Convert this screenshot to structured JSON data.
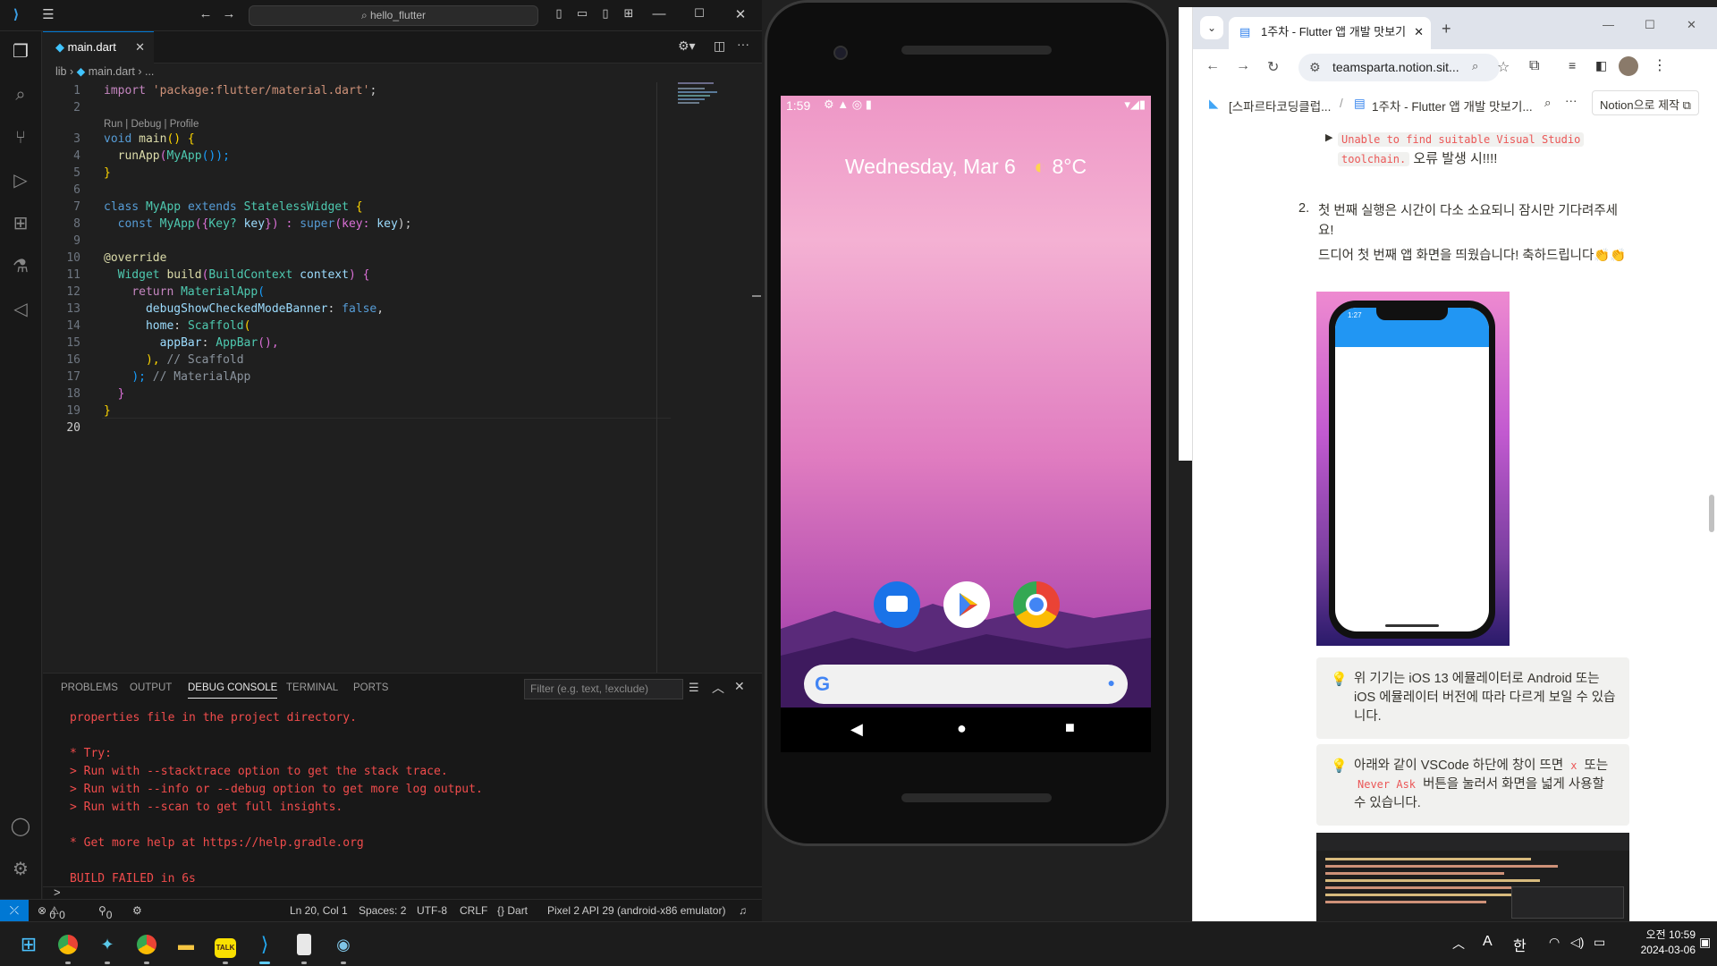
{
  "vscode": {
    "search": "hello_flutter",
    "tab": "main.dart",
    "breadcrumb": {
      "folder": "lib",
      "file": "main.dart",
      "more": "..."
    },
    "codelens": "Run | Debug | Profile",
    "line_numbers": [
      "1",
      "2",
      "3",
      "4",
      "5",
      "6",
      "7",
      "8",
      "9",
      "10",
      "11",
      "12",
      "13",
      "14",
      "15",
      "16",
      "17",
      "18",
      "19",
      "20"
    ],
    "code": {
      "l1_kw": "import",
      "l1_str": "'package:flutter/material.dart'",
      "l1_end": ";",
      "l3_kw": "void",
      "l3_fn": "main",
      "l3_rest": "() {",
      "l4_fn": "runApp",
      "l4_ty": "MyApp",
      "l4_rest": "());",
      "l5": "}",
      "l7_kw": "class",
      "l7_ty": "MyApp",
      "l7_kw2": "extends",
      "l7_ty2": "StatelessWidget",
      "l7_br": "{",
      "l8_kw": "const",
      "l8_ty": "MyApp",
      "l8_a": "({",
      "l8_ty2": "Key?",
      "l8_pa": "key",
      "l8_b": "}) :",
      "l8_kw2": "super",
      "l8_c": "(key:",
      "l8_pa2": "key",
      "l8_d": ");",
      "l10": "@override",
      "l11_ty": "Widget",
      "l11_fn": "build",
      "l11_a": "(",
      "l11_ty2": "BuildContext",
      "l11_pa": "context",
      "l11_b": ") {",
      "l12_kw": "return",
      "l12_ty": "MaterialApp",
      "l12_b": "(",
      "l13_pa": "debugShowCheckedModeBanner",
      "l13_c": ":",
      "l13_kw": "false",
      "l13_e": ",",
      "l14_pa": "home",
      "l14_c": ":",
      "l14_ty": "Scaffold",
      "l14_b": "(",
      "l15_pa": "appBar",
      "l15_c": ":",
      "l15_ty": "AppBar",
      "l15_e": "(),",
      "l16_b": "),",
      "l16_cm": "// Scaffold",
      "l17_b": ");",
      "l17_cm": "// MaterialApp",
      "l18": "}",
      "l19": "}"
    },
    "panel": {
      "tabs": [
        "PROBLEMS",
        "OUTPUT",
        "DEBUG CONSOLE",
        "TERMINAL",
        "PORTS"
      ],
      "filter_placeholder": "Filter (e.g. text, !exclude)",
      "lines": [
        "properties file in the project directory.",
        "",
        "* Try:",
        "> Run with --stacktrace option to get the stack trace.",
        "> Run with --info or --debug option to get more log output.",
        "> Run with --scan to get full insights.",
        "",
        "* Get more help at https://help.gradle.org",
        "",
        "BUILD FAILED in 6s"
      ],
      "prompt": ">"
    },
    "status": {
      "errors": "0",
      "warnings": "0",
      "ports": "0",
      "position": "Ln 20, Col 1",
      "spaces": "Spaces: 2",
      "encoding": "UTF-8",
      "eol": "CRLF",
      "language": "{} Dart",
      "device": "Pixel 2 API 29 (android-x86 emulator)"
    }
  },
  "emulator": {
    "time": "1:59",
    "date": "Wednesday, Mar 6",
    "temp": "8°C"
  },
  "chrome": {
    "tab_title": "1주차 - Flutter 앱 개발 맛보기",
    "url": "teamsparta.notion.sit...",
    "breadcrumb1": "[스파르타코딩클럽...",
    "breadcrumb_sep": "/",
    "breadcrumb2": "1주차 - Flutter 앱 개발 맛보기...",
    "notion_btn": "Notion으로 제작",
    "toggle_code1": "Unable to find suitable Visual Studio",
    "toggle_code2": "toolchain.",
    "toggle_tail": "오류 발생 시!!!!",
    "item_num": "2.",
    "item_text": "첫 번째 실행은 시간이 다소 소요되니 잠시만 기다려주세요!",
    "congrats": "드디어 첫 번째 앱 화면을 띄웠습니다! 축하드립니다👏👏",
    "phone_time": "1:27",
    "callout1": "위 기기는 iOS 13 에뮬레이터로 Android 또는 iOS 에뮬레이터 버전에 따라 다르게 보일 수 있습니다.",
    "callout2_a": "아래와 같이 VSCode 하단에 창이 뜨면",
    "callout2_x": "x",
    "callout2_b": "또는",
    "callout2_never": "Never Ask",
    "callout2_c": "버튼을 눌러서 화면을 넓게 사용할 수 있습니다."
  },
  "taskbar": {
    "clock_ampm": "오전 10:59",
    "clock_date": "2024-03-06",
    "ime": "한",
    "ime_a": "A"
  }
}
